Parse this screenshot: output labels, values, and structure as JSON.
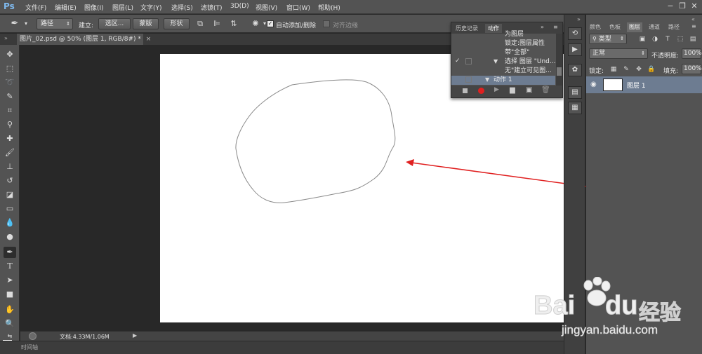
{
  "app": {
    "logo": "Ps"
  },
  "menu": [
    "文件(F)",
    "编辑(E)",
    "图像(I)",
    "图层(L)",
    "文字(Y)",
    "选择(S)",
    "滤镜(T)",
    "3D(D)",
    "视图(V)",
    "窗口(W)",
    "帮助(H)"
  ],
  "options": {
    "mode_value": "路径",
    "make_label": "建立:",
    "selection_button": "选区...",
    "mask_button": "蒙版",
    "shape_button": "形状",
    "auto_add_delete_label": "自动添加/删除",
    "auto_add_delete_checked": true,
    "align_edges_label": "对齐边缘"
  },
  "document": {
    "tab_title": "图片_02.psd @ 50% (图层 1, RGB/8#) *",
    "status_text": "文档:4.33M/1.06M",
    "timeline_label": "时间轴"
  },
  "actions_panel": {
    "tabs": [
      "历史记录",
      "动作"
    ],
    "active_tab": "动作",
    "rows": [
      "为图层",
      "锁定:图层属性",
      "带\"全部\"",
      "选择 图层 \"Und...",
      "无\"建立可见图...",
      "动作 1"
    ]
  },
  "layers_panel": {
    "tabs": [
      "颜色",
      "色板",
      "图层",
      "通道",
      "路径"
    ],
    "active_tab": "图层",
    "filter_label": "类型",
    "blend_mode": "正常",
    "opacity_label": "不透明度:",
    "opacity_value": "100%",
    "lock_label": "锁定:",
    "fill_label": "填充:",
    "fill_value": "100%",
    "layer_name": "图层 1"
  },
  "watermark": {
    "brand": "Bai",
    "brand_suffix": "du",
    "product": "经验",
    "url": "jingyan.baidu.com"
  },
  "colors": {
    "foreground": "#1010ff",
    "arrow": "#e02020",
    "selection_highlight": "#6d7c91"
  }
}
